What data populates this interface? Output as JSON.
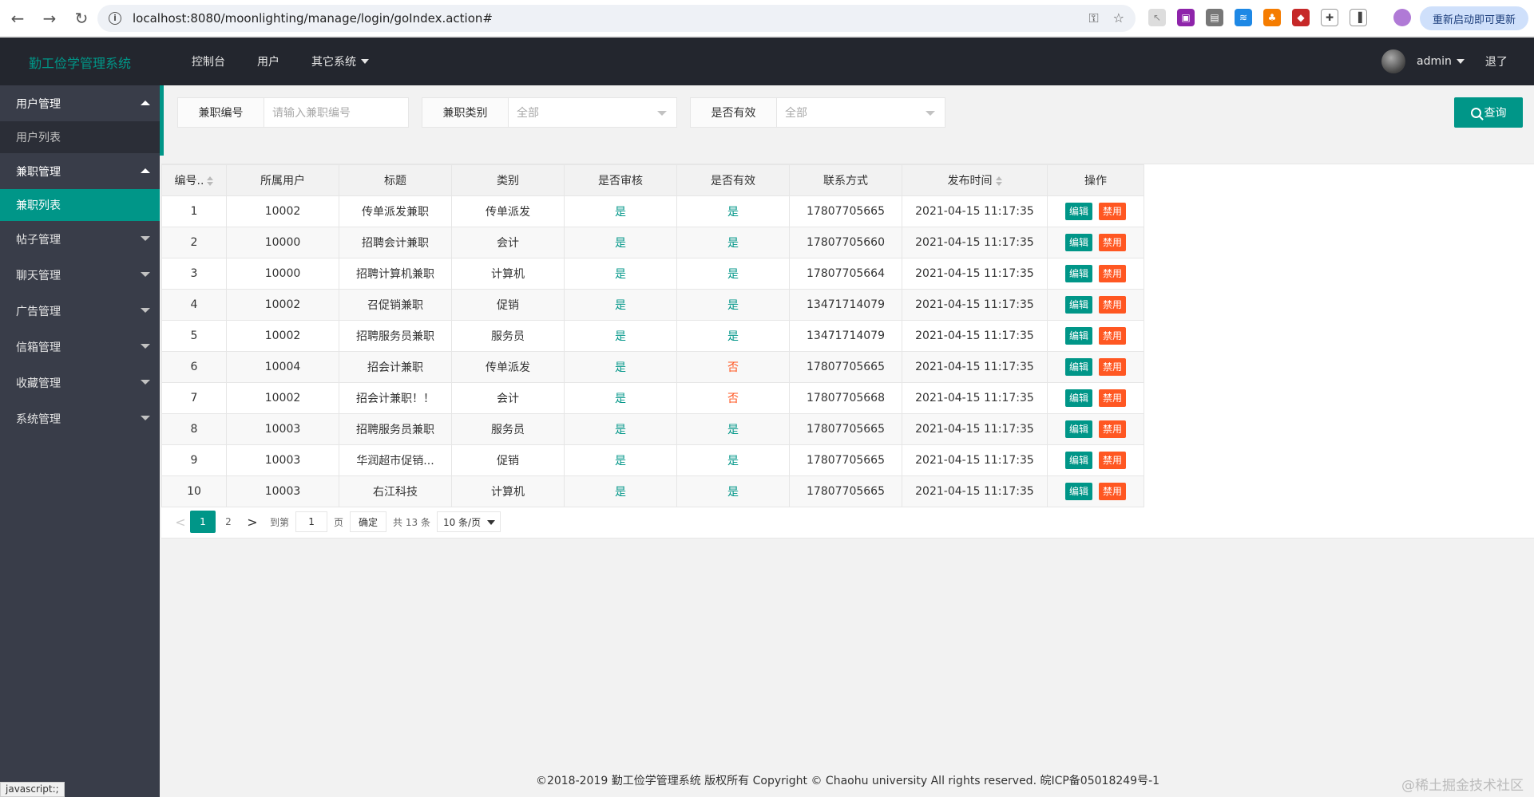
{
  "browser": {
    "url": "localhost:8080/moonlighting/manage/login/goIndex.action#",
    "update_label": "重新启动即可更新"
  },
  "header": {
    "logo": "勤工俭学管理系统",
    "nav": [
      "控制台",
      "用户",
      "其它系统"
    ],
    "user": "admin",
    "logout": "退了"
  },
  "sidebar": {
    "groups": [
      {
        "label": "用户管理",
        "open": true,
        "sub": [
          "用户列表"
        ]
      },
      {
        "label": "兼职管理",
        "open": true,
        "sub": [
          "兼职列表"
        ]
      },
      {
        "label": "帖子管理"
      },
      {
        "label": "聊天管理"
      },
      {
        "label": "广告管理"
      },
      {
        "label": "信箱管理"
      },
      {
        "label": "收藏管理"
      },
      {
        "label": "系统管理"
      }
    ],
    "status": "javascript:;"
  },
  "filters": {
    "id_label": "兼职编号",
    "id_placeholder": "请输入兼职编号",
    "type_label": "兼职类别",
    "type_value": "全部",
    "valid_label": "是否有效",
    "valid_value": "全部",
    "query_label": "查询"
  },
  "table": {
    "headers": [
      "编号..",
      "所属用户",
      "标题",
      "类别",
      "是否审核",
      "是否有效",
      "联系方式",
      "发布时间",
      "操作"
    ],
    "rows": [
      [
        "1",
        "10002",
        "传单派发兼职",
        "传单派发",
        "是",
        "是",
        "17807705665",
        "2021-04-15 11:17:35"
      ],
      [
        "2",
        "10000",
        "招聘会计兼职",
        "会计",
        "是",
        "是",
        "17807705660",
        "2021-04-15 11:17:35"
      ],
      [
        "3",
        "10000",
        "招聘计算机兼职",
        "计算机",
        "是",
        "是",
        "17807705664",
        "2021-04-15 11:17:35"
      ],
      [
        "4",
        "10002",
        "召促销兼职",
        "促销",
        "是",
        "是",
        "13471714079",
        "2021-04-15 11:17:35"
      ],
      [
        "5",
        "10002",
        "招聘服务员兼职",
        "服务员",
        "是",
        "是",
        "13471714079",
        "2021-04-15 11:17:35"
      ],
      [
        "6",
        "10004",
        "招会计兼职",
        "传单派发",
        "是",
        "否",
        "17807705665",
        "2021-04-15 11:17:35"
      ],
      [
        "7",
        "10002",
        "招会计兼职！！",
        "会计",
        "是",
        "否",
        "17807705668",
        "2021-04-15 11:17:35"
      ],
      [
        "8",
        "10003",
        "招聘服务员兼职",
        "服务员",
        "是",
        "是",
        "17807705665",
        "2021-04-15 11:17:35"
      ],
      [
        "9",
        "10003",
        "华润超市促销...",
        "促销",
        "是",
        "是",
        "17807705665",
        "2021-04-15 11:17:35"
      ],
      [
        "10",
        "10003",
        "右江科技",
        "计算机",
        "是",
        "是",
        "17807705665",
        "2021-04-15 11:17:35"
      ]
    ],
    "edit_label": "编辑",
    "ban_label": "禁用"
  },
  "pager": {
    "prev": "<",
    "pages": [
      "1",
      "2"
    ],
    "next": ">",
    "goto_label": "到第",
    "goto_value": "1",
    "page_label": "页",
    "ok_label": "确定",
    "total": "共 13 条",
    "size": "10 条/页"
  },
  "footer": {
    "text": "©2018-2019 勤工俭学管理系统 版权所有  Copyright © Chaohu university All rights reserved. 皖ICP备05018249号-1",
    "watermark": "@稀土掘金技术社区"
  },
  "colors": {
    "accent": "#009688",
    "danger": "#ff5722",
    "dark": "#23262e",
    "sidebar": "#393d49"
  }
}
